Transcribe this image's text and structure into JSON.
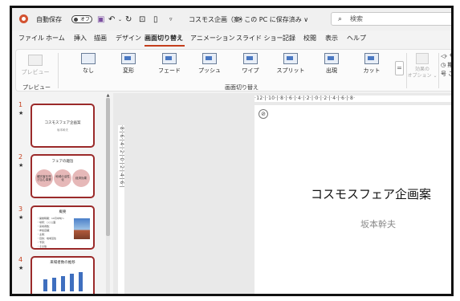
{
  "titlebar": {
    "autosave_label": "自動保存",
    "autosave_state": "オフ",
    "filename": "コスモス企画（案）",
    "save_status": "• この PC に保存済み ∨",
    "search_placeholder": "検索"
  },
  "menu": {
    "tabs": [
      "ファイル",
      "ホーム",
      "挿入",
      "描画",
      "デザイン",
      "画面切り替え",
      "アニメーション",
      "スライド ショー",
      "記録",
      "校閲",
      "表示",
      "ヘルプ"
    ],
    "active_tab": "画面切り替え"
  },
  "ribbon": {
    "preview_label": "プレビュー",
    "preview_group_label": "プレビュー",
    "transitions_group_label": "画面切り替え",
    "transitions": [
      "なし",
      "変形",
      "フェード",
      "プッシュ",
      "ワイプ",
      "スプリット",
      "出現",
      "カット"
    ],
    "more_symbol": "=",
    "effect_options_label_1": "効果の",
    "effect_options_label_2": "オプション ⌄",
    "timing_items": [
      "◁› サ",
      "◷ 期",
      "号 こ"
    ]
  },
  "slides": [
    {
      "number": "1",
      "star": "★",
      "title": "コスモスフェア企画案",
      "subtitle": "坂本幹夫"
    },
    {
      "number": "2",
      "star": "★",
      "title": "フェアの趣旨",
      "circles": [
        "観光客を呼び込む事業",
        "地域の活性化",
        "経済効果"
      ]
    },
    {
      "number": "3",
      "star": "★",
      "title": "概要",
      "bullets": [
        "・開催時期：10月中旬〜",
        "・場所：○○公園",
        "・来場者数：",
        "・参加店舗：",
        "・主催：",
        "・目的：地域活性",
        "・予算：",
        "・その他"
      ]
    },
    {
      "number": "4",
      "star": "★",
      "title": "来場者数の推移",
      "bars": [
        28,
        32,
        35,
        40,
        44
      ]
    }
  ],
  "rulers": {
    "horizontal": "·12·|·10·|·8·|·6·|·4·|·2·|·0·|·2·|·4·|·6·|·8·",
    "vertical": "·8·|·6·|·4·|·2·|·0·|·2·|·4·|·6·|"
  },
  "current_slide": {
    "title": "コスモスフェア企画案",
    "subtitle": "坂本幹夫"
  }
}
